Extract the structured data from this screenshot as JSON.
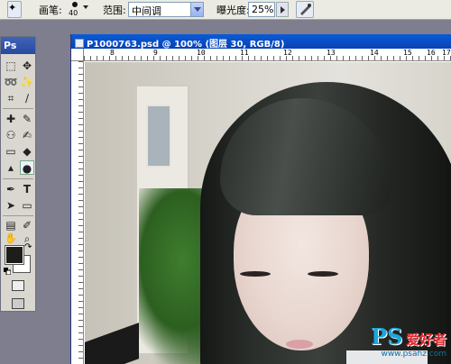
{
  "options_bar": {
    "brush_label": "画笔:",
    "brush_size": "40",
    "range_label": "范围:",
    "range_value": "中间调",
    "exposure_label": "曝光度:",
    "exposure_value": "25%"
  },
  "tools_panel": {
    "logo": "Ps"
  },
  "document": {
    "title": "P1000763.psd @ 100% (图层 30, RGB/8)",
    "ruler_top": [
      "8",
      "9",
      "10",
      "11",
      "12",
      "13",
      "14",
      "15",
      "16",
      "17"
    ]
  },
  "colors": {
    "foreground": "#1d1e1a",
    "background": "#ffffff",
    "titlebar": "#0a5bd7"
  },
  "watermark": {
    "brand_text": "PS",
    "chinese_text": "爱好者",
    "url": "www.psahz.com"
  }
}
